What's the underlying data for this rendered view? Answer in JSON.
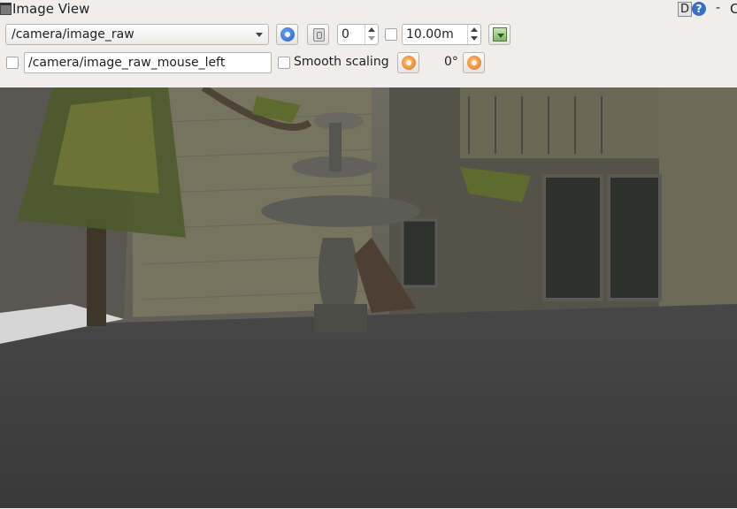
{
  "window": {
    "title": "Image View",
    "d_label": "D",
    "help_label": "?",
    "minimize_label": "-",
    "close_label": "C"
  },
  "toolbar": {
    "topic_select": {
      "value": "/camera/image_raw"
    },
    "num_gridlines": {
      "value": "0"
    },
    "max_range": {
      "value": "10.00m"
    },
    "mouse_topic": {
      "value": "/camera/image_raw_mouse_left"
    },
    "smooth_scaling": {
      "label": "Smooth scaling",
      "checked": false
    },
    "rotation": {
      "value": "0°"
    }
  },
  "colors": {
    "accent": "#3a6fc4",
    "ground": "#3d3d3d",
    "wall": "#7a7660",
    "foliage": "#5a6a2a"
  }
}
